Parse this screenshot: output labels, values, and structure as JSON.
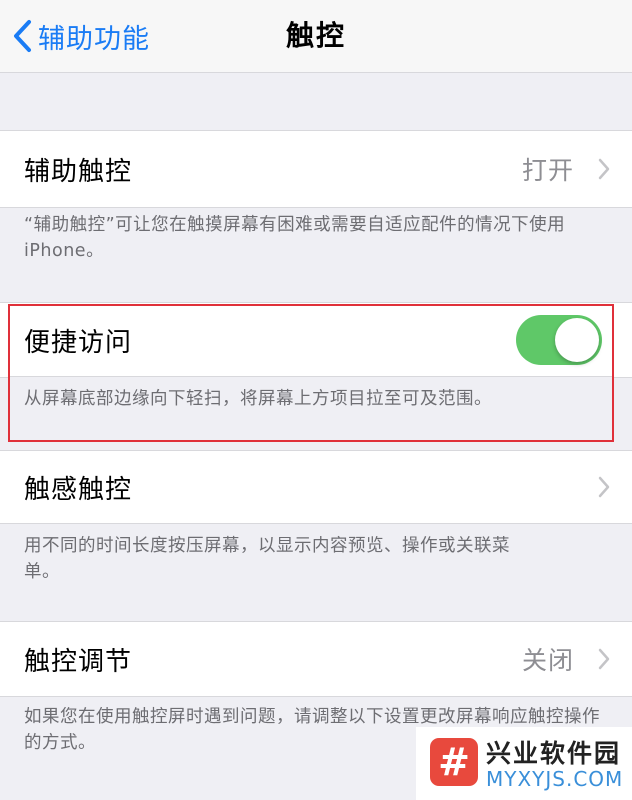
{
  "nav": {
    "back_label": "辅助功能",
    "title": "触控"
  },
  "assistive_touch": {
    "label": "辅助触控",
    "value": "打开",
    "footer": "“辅助触控”可让您在触摸屏幕有困难或需要自适应配件的情况下使用 iPhone。"
  },
  "reachability": {
    "label": "便捷访问",
    "toggle_on": true,
    "toggle_color": "#5fc868",
    "footer": "从屏幕底部边缘向下轻扫，将屏幕上方项目拉至可及范围。"
  },
  "haptic_touch": {
    "label": "触感触控",
    "footer": "用不同的时间长度按压屏幕，以显示内容预览、操作或关联菜单。"
  },
  "touch_accommodations": {
    "label": "触控调节",
    "value": "关闭",
    "footer": "如果您在使用触控屏时遇到问题，请调整以下设置更改屏幕响应触控操作的方式。"
  },
  "watermark": {
    "logo_glyph": "#",
    "name": "兴业软件园",
    "url": "MYXYJS.COM"
  },
  "colors": {
    "accent": "#1a7cf5",
    "highlight_border": "#e0303a"
  }
}
